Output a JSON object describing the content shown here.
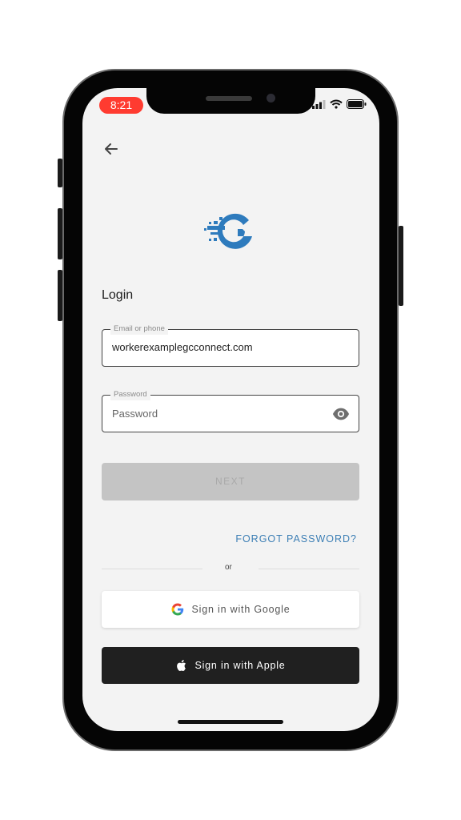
{
  "status_bar": {
    "time": "8:21"
  },
  "login": {
    "title": "Login",
    "email": {
      "label": "Email or phone",
      "value": "workerexamplegcconnect.com"
    },
    "password": {
      "label": "Password",
      "placeholder": "Password"
    },
    "next_label": "NEXT",
    "forgot_label": "FORGOT PASSWORD?",
    "or_label": "or",
    "google_label": "Sign in with Google",
    "apple_label": "Sign in with Apple"
  },
  "icons": {
    "back": "arrow-left-icon",
    "logo": "gc-logo",
    "eye": "eye-icon",
    "google": "google-icon",
    "apple": "apple-icon"
  },
  "colors": {
    "accent": "#3d7fb5",
    "logo_blue": "#2e7bbd",
    "status_pill": "#ff3b30",
    "disabled_button": "#c4c4c4",
    "apple_button": "#202020"
  }
}
